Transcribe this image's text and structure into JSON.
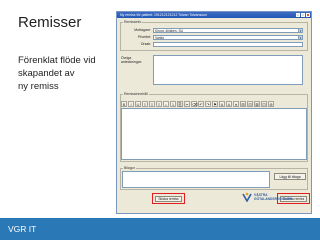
{
  "slide": {
    "title": "Remisser",
    "bullets": [
      "Förenklat flöde vid",
      "skapandet av",
      "ny remiss"
    ]
  },
  "footer": {
    "text": "VGR IT"
  },
  "window": {
    "title": "Ny remiss för patient: 191212121212 Tolvan Tolvansson",
    "sections": {
      "remissinfo": "Remissinfo",
      "remissinnehall": "Remissinnehåll",
      "bilagor": "Bilagor"
    },
    "fields": {
      "mottagare_label": "Mottagare:",
      "mottagare_value": "Kirurg. kliniken, SU",
      "prioritet_label": "Prioritet:",
      "prioritet_value": "Vanlig",
      "orsak_label": "Orsak:",
      "ovriga_label": "Övriga anteckningar:"
    },
    "toolbar_icons": [
      "B",
      "I",
      "U",
      "≡",
      "≡",
      "≡",
      "•",
      "1",
      "⎘",
      "✂",
      "⌫",
      "↶",
      "↷",
      "⚑",
      "A",
      "A",
      "∗",
      "⊞",
      "⊟",
      "⊠",
      "⊡",
      "⊕"
    ],
    "buttons": {
      "add_attachment": "Lägg till bilaga",
      "send": "Skicka remiss",
      "cancel": "Radera remiss"
    },
    "logo": {
      "line1": "VÄSTRA",
      "line2": "GÖTALANDSREGIONEN"
    }
  }
}
